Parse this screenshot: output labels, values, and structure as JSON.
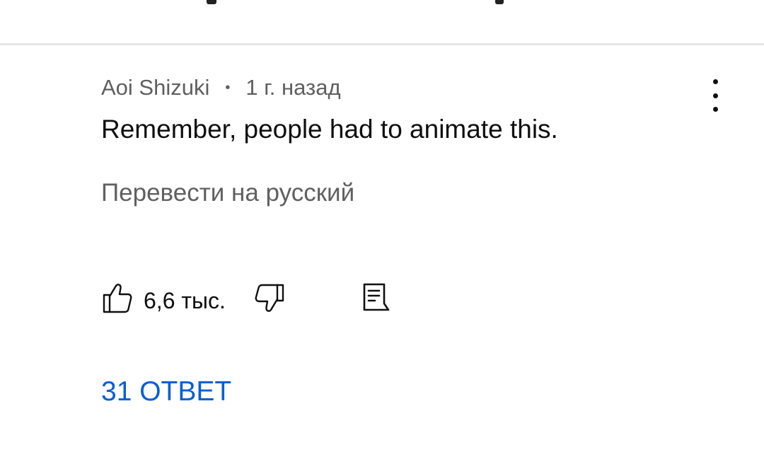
{
  "comment": {
    "author": "Aoi Shizuki",
    "separator": "•",
    "time_ago": "1 г. назад",
    "text": "Remember, people had to animate this.",
    "translate_label": "Перевести на русский",
    "like_count": "6,6 тыс.",
    "replies_label": "31 ОТВЕТ"
  },
  "icons": {
    "like": "thumbs-up-icon",
    "dislike": "thumbs-down-icon",
    "reply": "comment-reply-icon",
    "more": "more-vertical-icon"
  },
  "colors": {
    "accent": "#065fd4",
    "text_primary": "#0f0f0f",
    "text_secondary": "#606060",
    "divider": "#e6e6e6"
  }
}
